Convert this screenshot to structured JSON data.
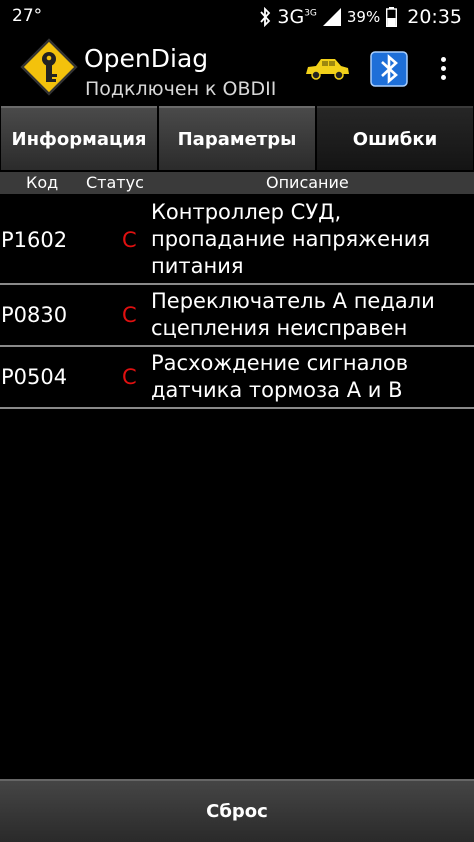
{
  "status_bar": {
    "temperature": "27°",
    "network": "3G",
    "network_sup": "3G",
    "battery": "39%",
    "time": "20:35"
  },
  "app": {
    "title": "OpenDiag",
    "subtitle": "Подключен к OBDII"
  },
  "tabs": [
    {
      "label": "Информация",
      "active": false
    },
    {
      "label": "Параметры",
      "active": false
    },
    {
      "label": "Ошибки",
      "active": true
    }
  ],
  "columns": {
    "code": "Код",
    "status": "Статус",
    "description": "Описание"
  },
  "errors": [
    {
      "code": "P1602",
      "status": "С",
      "description": "Контроллер СУД, пропадание напряжения питания"
    },
    {
      "code": "P0830",
      "status": "С",
      "description": "Переключатель А педали сцепления неисправен"
    },
    {
      "code": "P0504",
      "status": "С",
      "description": "Расхождение сигналов датчика тормоза А и В"
    }
  ],
  "reset_button": "Сброс",
  "colors": {
    "status_red": "#e01010",
    "car_yellow": "#f2d11a",
    "bluetooth_blue": "#1e6fd8"
  }
}
